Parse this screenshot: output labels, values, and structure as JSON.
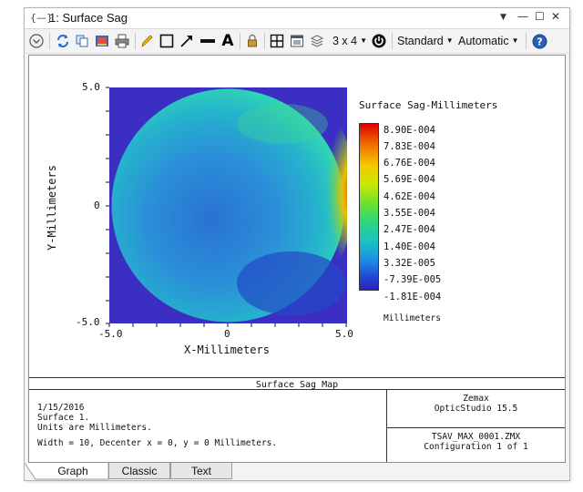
{
  "window": {
    "title": "1: Surface Sag",
    "icons": [
      "app-icon",
      "dropdown-icon",
      "minimize-icon",
      "maximize-icon",
      "close-icon"
    ]
  },
  "toolbar": {
    "icons": [
      "settings-chevron-icon",
      "refresh-icon",
      "copy-icon",
      "export-icon",
      "print-icon",
      "pencil-icon",
      "rectangle-icon",
      "arrow-icon",
      "line-icon",
      "text-icon",
      "lock-icon",
      "layout-icon",
      "window-icon",
      "layers-icon",
      "grid-icon",
      "power-icon",
      "help-icon"
    ],
    "grid_label": "3 x 4",
    "standard_label": "Standard",
    "automatic_label": "Automatic"
  },
  "plot": {
    "title": "Surface Sag-Millimeters",
    "xlabel": "X-Millimeters",
    "ylabel": "Y-Millimeters",
    "x_ticks": [
      "-5.0",
      "0",
      "5.0"
    ],
    "y_ticks": [
      "5.0",
      "0",
      "-5.0"
    ],
    "colorbar_labels": [
      "8.90E-004",
      "7.83E-004",
      "6.76E-004",
      "5.69E-004",
      "4.62E-004",
      "3.55E-004",
      "2.47E-004",
      "1.40E-004",
      "3.32E-005",
      "-7.39E-005",
      "-1.81E-004"
    ],
    "colorbar_unit": "Millimeters",
    "colors": {
      "background": "#3a2fc2",
      "center": "#2a7fd6",
      "edge": "#2fd0c0",
      "hot": "#e0e000"
    }
  },
  "caption": "Surface Sag Map",
  "info": {
    "lines": [
      "1/15/2016",
      "Surface 1.",
      "Units are Millimeters."
    ],
    "width_line": "Width = 10, Decenter x = 0, y = 0 Millimeters.",
    "company": "Zemax",
    "product": "OpticStudio 15.5",
    "file": "TSAV_MAX_0001.ZMX",
    "configuration": "Configuration 1 of 1"
  },
  "tabs": [
    "Graph",
    "Classic",
    "Text"
  ]
}
